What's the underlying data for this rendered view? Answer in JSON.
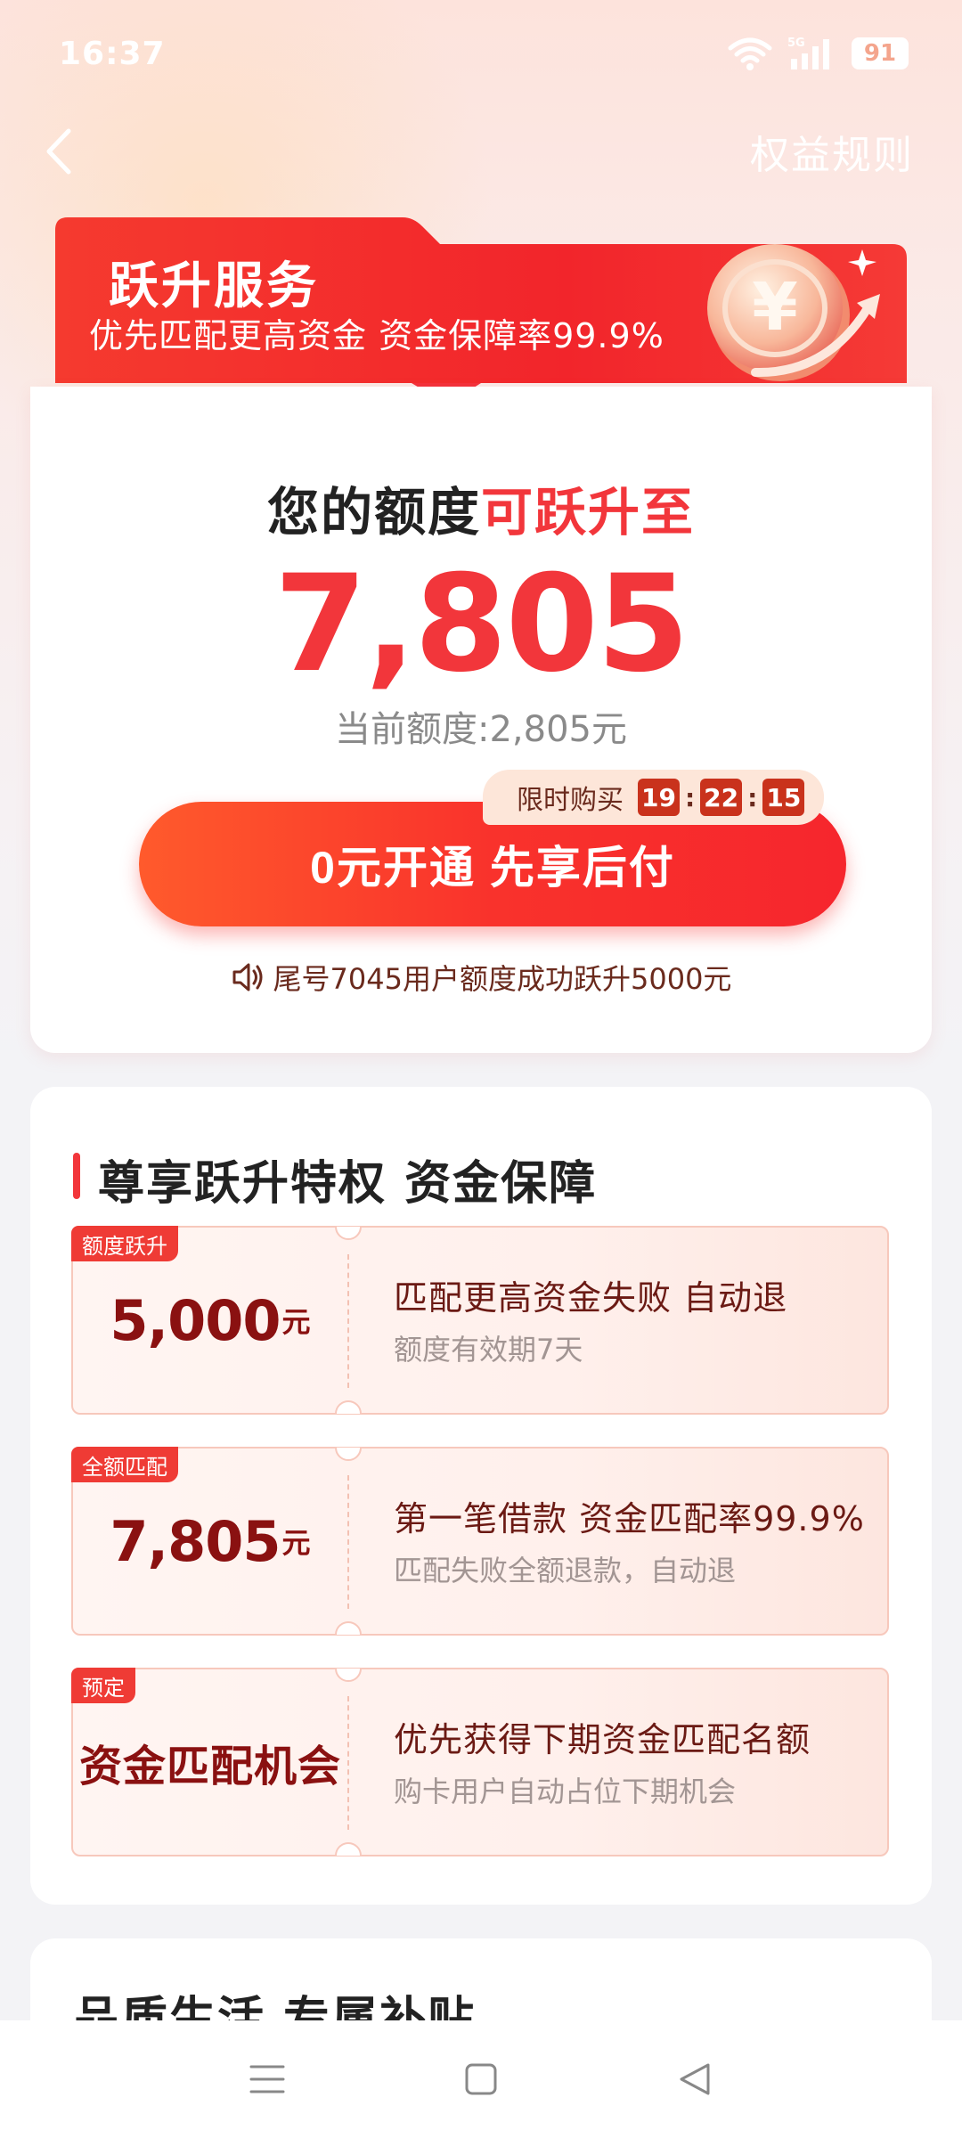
{
  "status_bar": {
    "time": "16:37",
    "network": "5G",
    "battery": "91"
  },
  "nav": {
    "rules_label": "权益规则",
    "back_icon": "chevron-left-icon"
  },
  "banner": {
    "title": "跃升服务",
    "subtitle": "优先匹配更高资金 资金保障率99.9%",
    "icon": "yen-coin-icon"
  },
  "quota": {
    "heading_prefix": "您的额度",
    "heading_highlight": "可跃升至",
    "amount": "7,805",
    "current": "当前额度:2,805元"
  },
  "countdown": {
    "label": "限时购买",
    "hours": "19",
    "minutes": "22",
    "seconds": "15"
  },
  "cta": {
    "label": "0元开通 先享后付"
  },
  "notice": {
    "text": "尾号7045用户额度成功跃升5000元",
    "icon": "speaker-icon"
  },
  "privileges": {
    "title": "尊享跃升特权 资金保障",
    "items": [
      {
        "tag": "额度跃升",
        "amount": "5,000",
        "unit": "元",
        "main": "匹配更高资金失败 自动退",
        "sub": "额度有效期7天"
      },
      {
        "tag": "全额匹配",
        "amount": "7,805",
        "unit": "元",
        "main": "第一笔借款 资金匹配率99.9%",
        "sub": "匹配失败全额退款，自动退"
      },
      {
        "tag": "预定",
        "left_text": "资金匹配机会",
        "main": "优先获得下期资金匹配名额",
        "sub": "购卡用户自动占位下期机会"
      }
    ]
  },
  "next_section": {
    "title": "品质生活 专属补贴"
  },
  "colors": {
    "accent": "#f2363b",
    "dark_red": "#8a1111",
    "tag_red": "#ef3b35"
  }
}
